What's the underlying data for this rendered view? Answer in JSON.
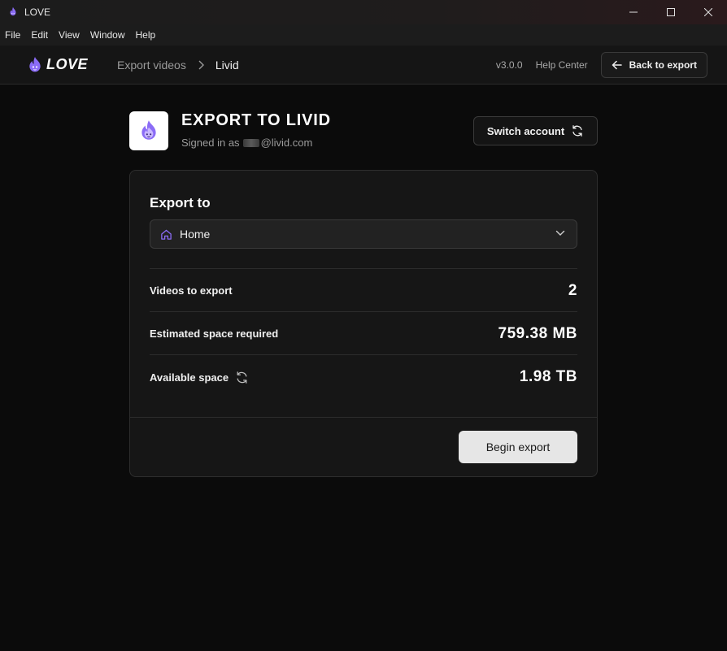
{
  "window": {
    "title": "LOVE",
    "icon": "flame-icon"
  },
  "menu": [
    "File",
    "Edit",
    "View",
    "Window",
    "Help"
  ],
  "header": {
    "logo_text": "LOVE",
    "breadcrumb": [
      "Export videos",
      "Livid"
    ],
    "version": "v3.0.0",
    "help_link": "Help Center",
    "back_button": "Back to export"
  },
  "heading": {
    "title": "EXPORT TO LIVID",
    "signed_in_prefix": "Signed in as",
    "signed_in_domain": "@livid.com",
    "switch_account": "Switch account"
  },
  "card": {
    "export_label": "Export to",
    "destination": "Home",
    "rows": [
      {
        "label": "Videos to export",
        "value": "2"
      },
      {
        "label": "Estimated space required",
        "value": "759.38 MB"
      },
      {
        "label": "Available space",
        "value": "1.98 TB"
      }
    ],
    "begin_button": "Begin export"
  },
  "colors": {
    "brand": "#8b6cf6",
    "background": "#0b0b0b",
    "card": "#161616",
    "primary_button": "#e6e6e6"
  }
}
